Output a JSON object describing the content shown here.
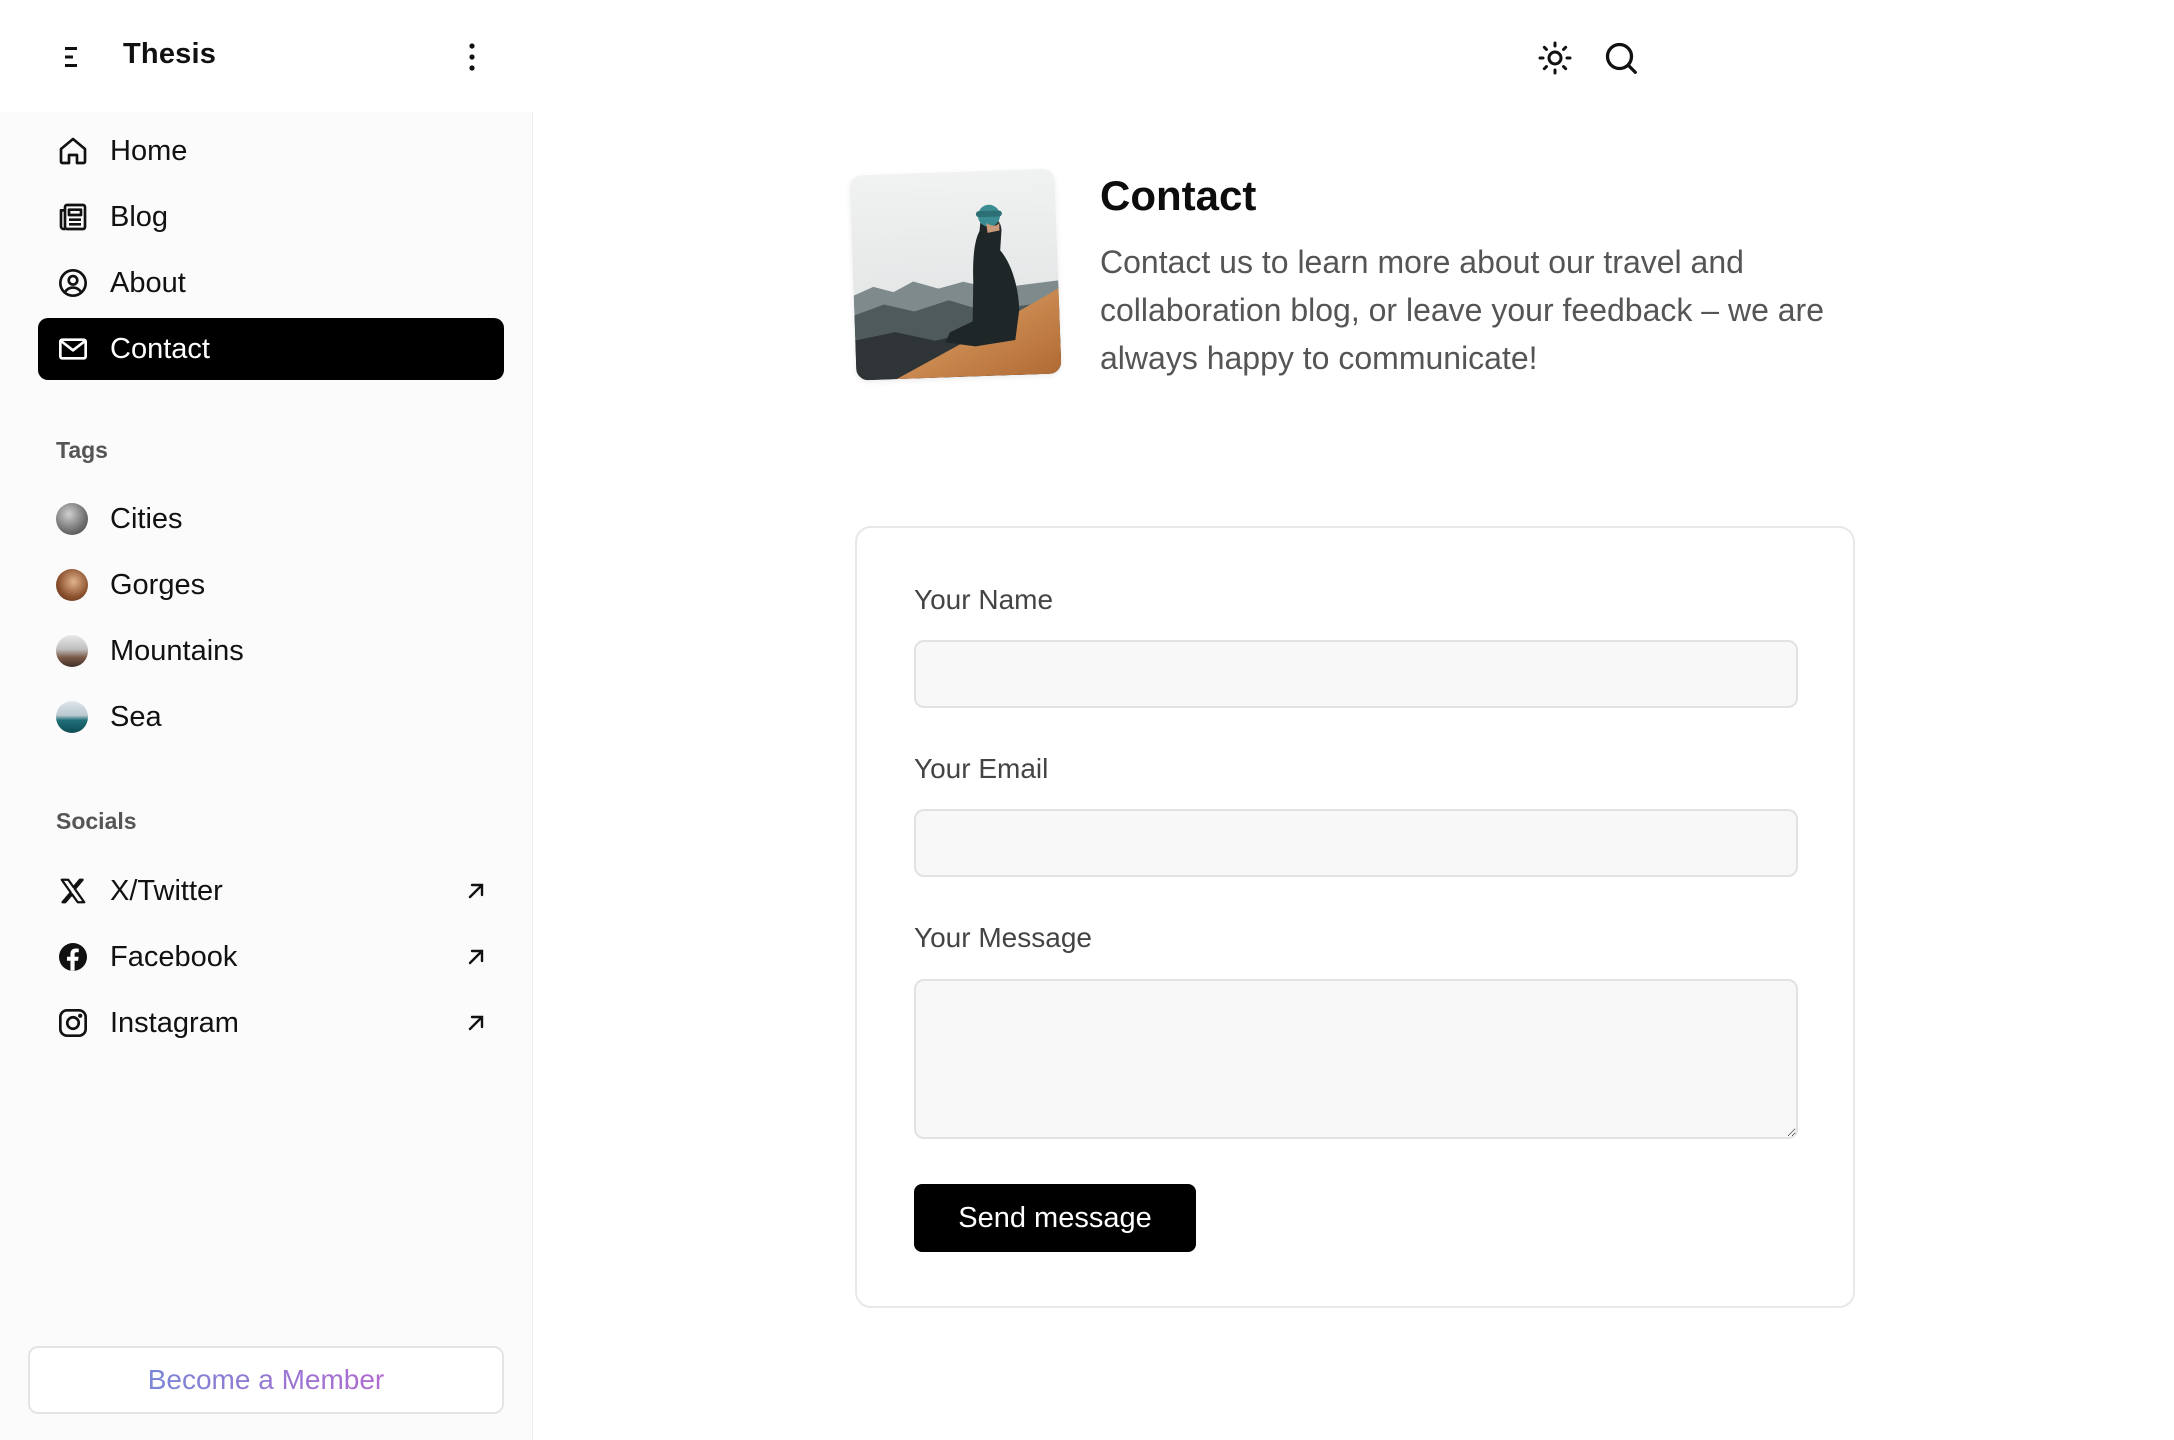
{
  "brand": "Thesis",
  "nav": [
    {
      "label": "Home",
      "icon": "home-icon"
    },
    {
      "label": "Blog",
      "icon": "newspaper-icon"
    },
    {
      "label": "About",
      "icon": "user-circle-icon"
    },
    {
      "label": "Contact",
      "icon": "mail-icon",
      "active": true
    }
  ],
  "tags": {
    "title": "Tags",
    "items": [
      {
        "label": "Cities"
      },
      {
        "label": "Gorges"
      },
      {
        "label": "Mountains"
      },
      {
        "label": "Sea"
      }
    ]
  },
  "socials": {
    "title": "Socials",
    "items": [
      {
        "label": "X/Twitter",
        "icon": "x-twitter-icon"
      },
      {
        "label": "Facebook",
        "icon": "facebook-icon"
      },
      {
        "label": "Instagram",
        "icon": "instagram-icon"
      }
    ]
  },
  "member_button": "Become a Member",
  "page": {
    "title": "Contact",
    "description": "Contact us to learn more about our travel and collaboration blog, or leave your feedback – we are always happy to communicate!"
  },
  "form": {
    "name_label": "Your Name",
    "name_value": "",
    "email_label": "Your Email",
    "email_value": "",
    "message_label": "Your Message",
    "message_value": "",
    "submit_label": "Send message"
  },
  "colors": {
    "accent": "#000000",
    "member_gradient_start": "#7a86d6",
    "member_gradient_end": "#b06ad0"
  }
}
